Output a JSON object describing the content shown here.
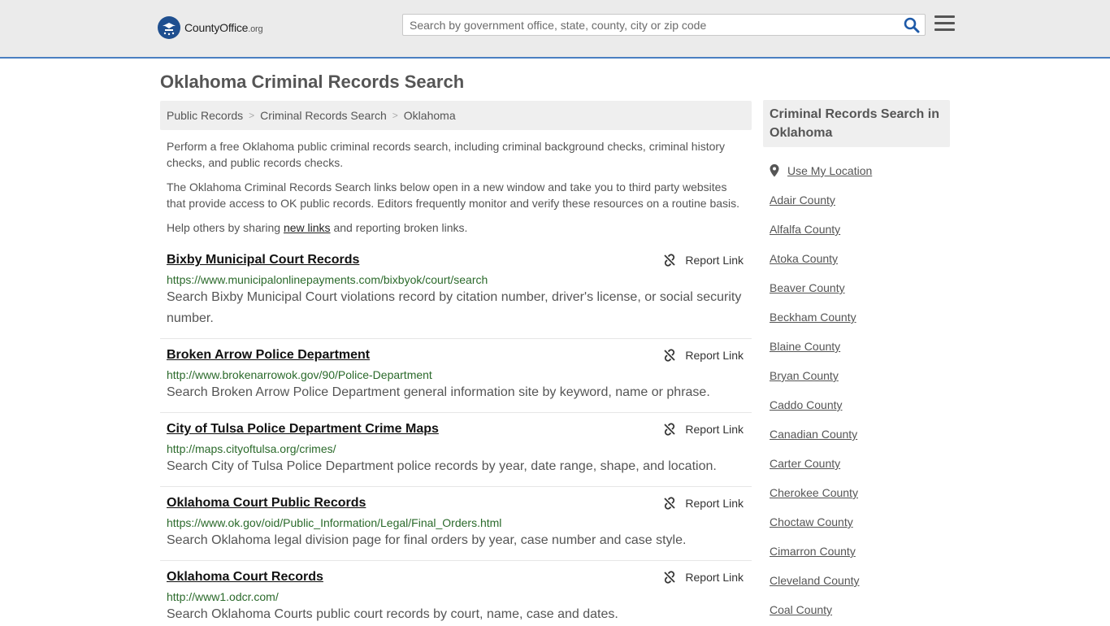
{
  "header": {
    "logo_text": "CountyOffice",
    "logo_tld": ".org",
    "search_placeholder": "Search by government office, state, county, city or zip code"
  },
  "page": {
    "title": "Oklahoma Criminal Records Search",
    "breadcrumb": [
      "Public Records",
      "Criminal Records Search",
      "Oklahoma"
    ],
    "intro": [
      "Perform a free Oklahoma public criminal records search, including criminal background checks, criminal history checks, and public records checks.",
      "The Oklahoma Criminal Records Search links below open in a new window and take you to third party websites that provide access to OK public records. Editors frequently monitor and verify these resources on a routine basis."
    ],
    "help_prefix": "Help others by sharing ",
    "help_link": "new links",
    "help_suffix": " and reporting broken links."
  },
  "report_label": "Report Link",
  "results": [
    {
      "title": "Bixby Municipal Court Records",
      "url": "https://www.municipalonlinepayments.com/bixbyok/court/search",
      "desc": "Search Bixby Municipal Court violations record by citation number, driver's license, or social security number."
    },
    {
      "title": "Broken Arrow Police Department",
      "url": "http://www.brokenarrowok.gov/90/Police-Department",
      "desc": "Search Broken Arrow Police Department general information site by keyword, name or phrase."
    },
    {
      "title": "City of Tulsa Police Department Crime Maps",
      "url": "http://maps.cityoftulsa.org/crimes/",
      "desc": "Search City of Tulsa Police Department police records by year, date range, shape, and location."
    },
    {
      "title": "Oklahoma Court Public Records",
      "url": "https://www.ok.gov/oid/Public_Information/Legal/Final_Orders.html",
      "desc": "Search Oklahoma legal division page for final orders by year, case number and case style."
    },
    {
      "title": "Oklahoma Court Records",
      "url": "http://www1.odcr.com/",
      "desc": "Search Oklahoma Courts public court records by court, name, case and dates."
    }
  ],
  "sidebar": {
    "heading": "Criminal Records Search in Oklahoma",
    "use_location": "Use My Location",
    "counties": [
      "Adair County",
      "Alfalfa County",
      "Atoka County",
      "Beaver County",
      "Beckham County",
      "Blaine County",
      "Bryan County",
      "Caddo County",
      "Canadian County",
      "Carter County",
      "Cherokee County",
      "Choctaw County",
      "Cimarron County",
      "Cleveland County",
      "Coal County"
    ]
  }
}
